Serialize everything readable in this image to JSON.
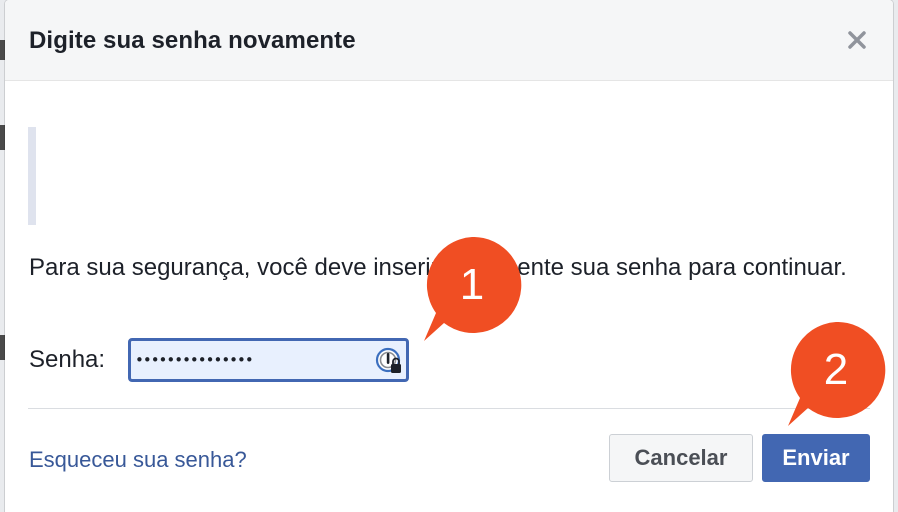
{
  "dialog": {
    "title": "Digite sua senha novamente",
    "message": "Para sua segurança, você deve inserir novamente sua senha para continuar.",
    "password_label": "Senha:",
    "password_value": "•••••••••••••••",
    "forgot_link": "Esqueceu sua senha?",
    "cancel_label": "Cancelar",
    "submit_label": "Enviar"
  },
  "annotations": [
    {
      "number": "1",
      "color": "#f04e23"
    },
    {
      "number": "2",
      "color": "#f04e23"
    }
  ],
  "colors": {
    "primary": "#4267b2",
    "link": "#385898",
    "header_bg": "#f5f6f7",
    "callout": "#f04e23"
  }
}
